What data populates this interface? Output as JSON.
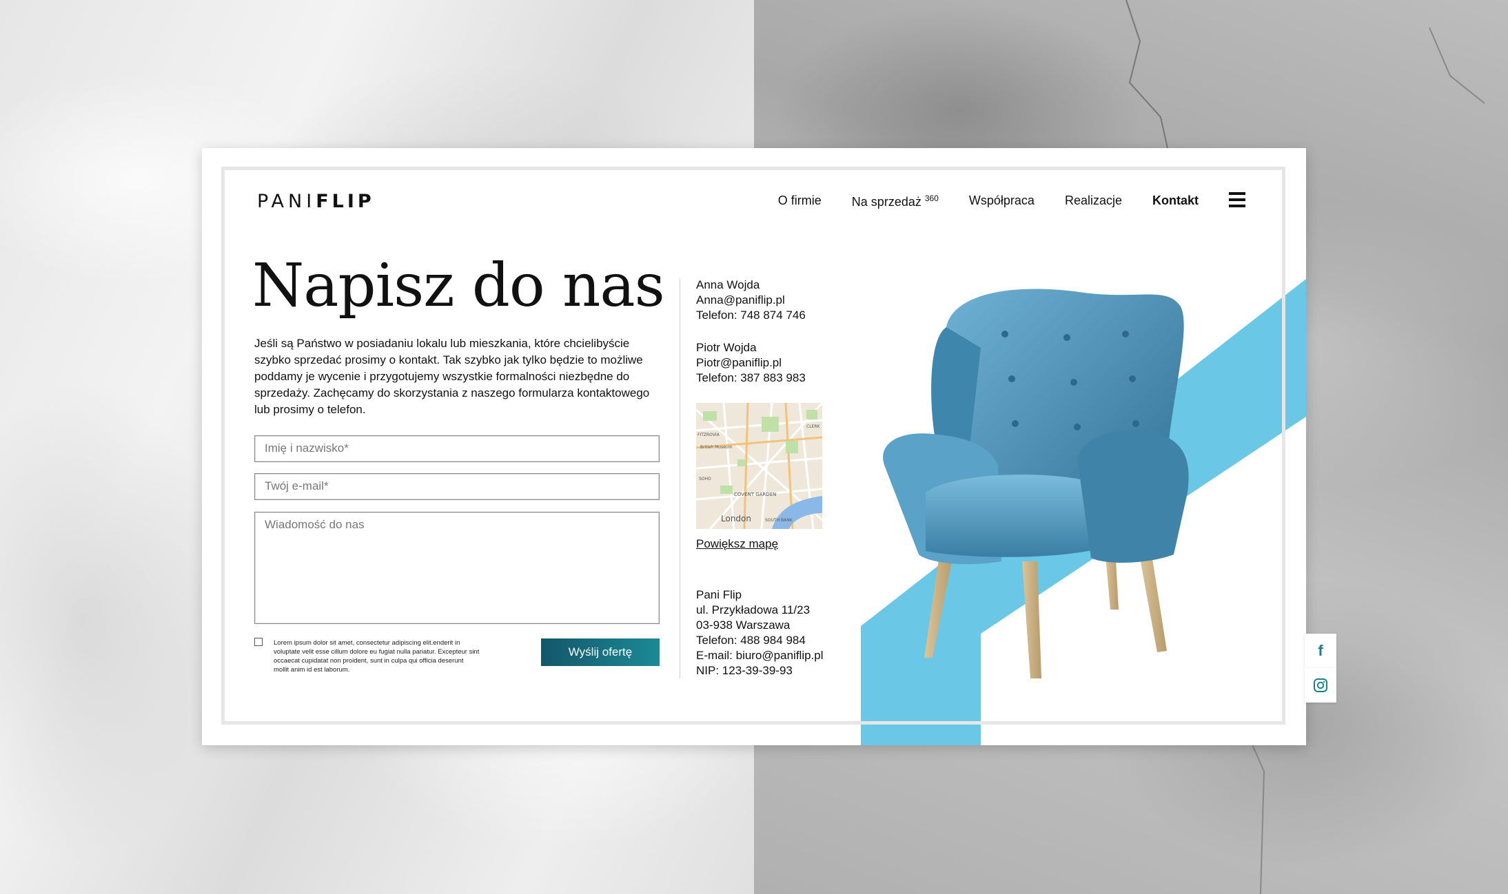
{
  "brand": {
    "logo_light": "PANI",
    "logo_bold": "FLIP"
  },
  "nav": {
    "items": [
      {
        "label": "O firmie"
      },
      {
        "label": "Na sprzedaż",
        "sup": "360"
      },
      {
        "label": "Współpraca"
      },
      {
        "label": "Realizacje"
      },
      {
        "label": "Kontakt",
        "active": true
      }
    ]
  },
  "main": {
    "title": "Napisz do nas",
    "intro": "Jeśli są Państwo w posiadaniu lokalu lub mieszkania, które chcielibyście szybko sprzedać prosimy o kontakt. Tak szybko jak tylko będzie to możliwe poddamy je wycenie i przygotujemy wszystkie formalności niezbędne do sprzedaży. Zachęcamy do skorzystania z naszego formularza kontaktowego lub prosimy o telefon."
  },
  "form": {
    "name_placeholder": "Imię i nazwisko*",
    "email_placeholder": "Twój e-mail*",
    "message_placeholder": "Wiadomość do nas",
    "consent": "Lorem ipsum dolor sit amet, consectetur adipiscing elit.enderit in voluptate velit esse cillum dolore eu fugiat nulla pariatur. Excepteur sint occaecat cupidatat non proident, sunt in culpa qui officia deserunt mollit anim id est laborum.",
    "submit_label": "Wyślij ofertę"
  },
  "contacts": {
    "anna": {
      "name": "Anna Wojda",
      "email": "Anna@paniflip.pl",
      "phone": "Telefon: 748 874 746"
    },
    "piotr": {
      "name": "Piotr Wojda",
      "email": "Piotr@paniflip.pl",
      "phone": "Telefon: 387 883 983"
    },
    "company": {
      "name": "Pani Flip",
      "street": "ul. Przykładowa 11/23",
      "city": "03-938 Warszawa",
      "phone": "Telefon: 488 984 984",
      "email": "E-mail: biuro@paniflip.pl",
      "nip": "NIP: 123-39-39-93"
    }
  },
  "map": {
    "link_label": "Powiększ mapę",
    "labels": {
      "covent": "COVENT GARDEN",
      "london": "London",
      "soho": "SOHO",
      "museum": "British Museum",
      "south": "SOUTH BANK",
      "fitz": "FITZROVIA",
      "clerk": "CLERK"
    }
  },
  "colors": {
    "accent": "#6ac8e6",
    "button": "#1c7f8e",
    "chair": "#4e93b8"
  },
  "social": {
    "facebook_icon": "f",
    "instagram_icon": "instagram"
  }
}
